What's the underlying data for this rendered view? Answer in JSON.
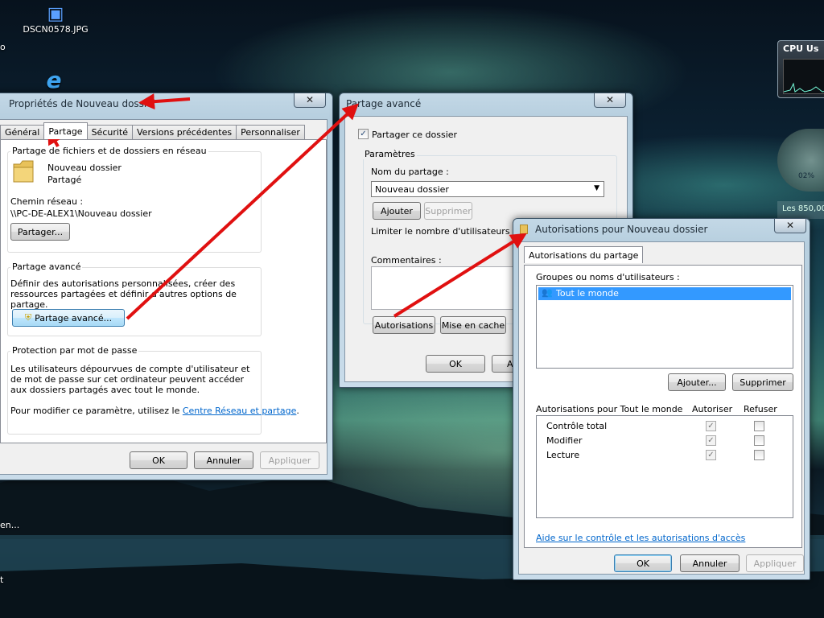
{
  "desktop": {
    "icon_photo_label": "DSCN0578.JPG",
    "icon_photo_glyph": "▣",
    "ie_glyph": "e",
    "stub_left_1": "en...",
    "stub_left_2": "t",
    "stub_left_top": "o",
    "gadget_cpu_title": "CPU Us",
    "gadget_gauge_value": "02%",
    "gadget_price": "Les 850,00"
  },
  "props_window": {
    "title": "Propriétés de Nouveau dossier",
    "close": "✕",
    "tabs": [
      "Général",
      "Partage",
      "Sécurité",
      "Versions précédentes",
      "Personnaliser"
    ],
    "active_tab": 1,
    "network_group": {
      "caption": "Partage de fichiers et de dossiers en réseau",
      "folder_name": "Nouveau dossier",
      "folder_state": "Partagé",
      "path_label": "Chemin réseau :",
      "path_value": "\\\\PC-DE-ALEX1\\Nouveau dossier",
      "share_button": "Partager..."
    },
    "advanced_group": {
      "caption": "Partage avancé",
      "description": "Définir des autorisations personnalisées, créer des ressources partagées et définir d'autres options de partage.",
      "button": "Partage avancé..."
    },
    "password_group": {
      "caption": "Protection par mot de passe",
      "description": "Les utilisateurs dépourvues de compte d'utilisateur et de mot de passe sur cet ordinateur peuvent accéder aux dossiers partagés avec tout le monde.",
      "modify_prefix": "Pour modifier ce paramètre, utilisez le ",
      "modify_link": "Centre Réseau et partage",
      "modify_suffix": "."
    },
    "ok": "OK",
    "cancel": "Annuler",
    "apply": "Appliquer"
  },
  "advanced_window": {
    "title": "Partage avancé",
    "close": "✕",
    "share_checkbox_label": "Partager ce dossier",
    "share_checked": "✓",
    "params_caption": "Paramètres",
    "share_name_label": "Nom du partage :",
    "share_name_value": "Nouveau dossier",
    "add_button": "Ajouter",
    "remove_button": "Supprimer",
    "limit_label": "Limiter le nombre d'utilisateurs simult",
    "comments_label": "Commentaires :",
    "permissions_button": "Autorisations",
    "cache_button": "Mise en cache",
    "ok": "OK",
    "cancel_stub": "An"
  },
  "perm_window": {
    "title": "Autorisations pour Nouveau dossier",
    "close": "✕",
    "tab": "Autorisations du partage",
    "groups_label": "Groupes ou noms d'utilisateurs :",
    "selected_group": "Tout le monde",
    "add_button": "Ajouter...",
    "remove_button": "Supprimer",
    "perms_header": "Autorisations pour Tout le monde",
    "allow_header": "Autoriser",
    "deny_header": "Refuser",
    "rows": [
      {
        "name": "Contrôle total",
        "allow": "✓",
        "deny": ""
      },
      {
        "name": "Modifier",
        "allow": "✓",
        "deny": ""
      },
      {
        "name": "Lecture",
        "allow": "✓",
        "deny": ""
      }
    ],
    "help_link": "Aide sur le contrôle et les autorisations d'accès",
    "ok": "OK",
    "cancel": "Annuler",
    "apply": "Appliquer"
  },
  "colors": {
    "annotation_arrow": "#e01010",
    "link": "#0066cc",
    "selection": "#3399ff"
  }
}
